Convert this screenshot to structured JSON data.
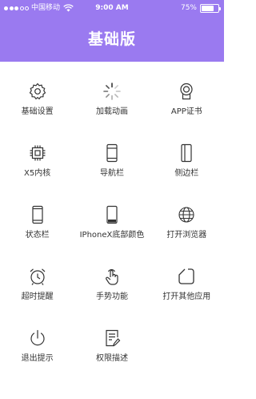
{
  "status_bar": {
    "carrier": "中国移动",
    "time": "9:00 AM",
    "battery_text": "75%",
    "battery_level": 0.75,
    "signal_bars_filled": 3,
    "signal_bars_total": 5
  },
  "header": {
    "title": "基础版",
    "background_color": "#9a7af0"
  },
  "menu": {
    "items": [
      {
        "label": "基础设置",
        "icon": "gear-icon"
      },
      {
        "label": "加载动画",
        "icon": "spinner-icon"
      },
      {
        "label": "APP证书",
        "icon": "certificate-icon"
      },
      {
        "label": "X5内核",
        "icon": "chip-icon"
      },
      {
        "label": "导航栏",
        "icon": "phone-navbar-icon"
      },
      {
        "label": "侧边栏",
        "icon": "phone-sidebar-icon"
      },
      {
        "label": "状态栏",
        "icon": "phone-statusbar-icon"
      },
      {
        "label": "IPhoneX底部颜色",
        "icon": "phone-bottom-icon"
      },
      {
        "label": "打开浏览器",
        "icon": "globe-icon"
      },
      {
        "label": "超时提醒",
        "icon": "alarm-clock-icon"
      },
      {
        "label": "手势功能",
        "icon": "gesture-hand-icon"
      },
      {
        "label": "打开其他应用",
        "icon": "open-app-icon"
      },
      {
        "label": "退出提示",
        "icon": "power-icon"
      },
      {
        "label": "权限描述",
        "icon": "document-edit-icon"
      }
    ]
  }
}
